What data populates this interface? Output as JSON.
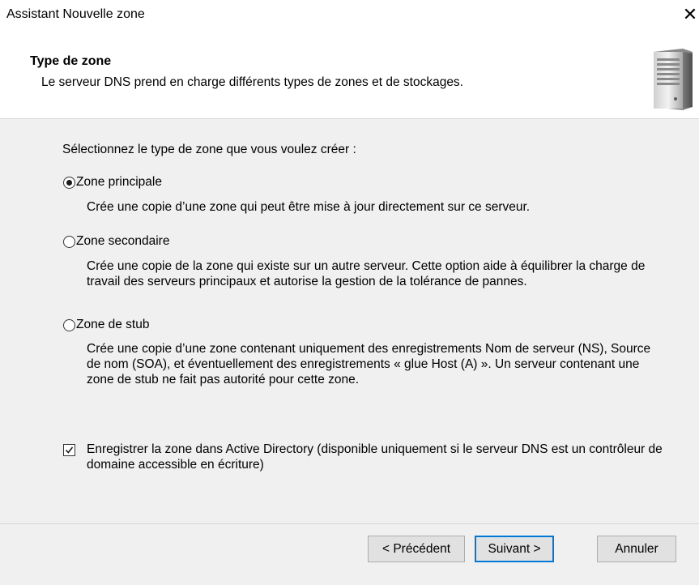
{
  "window": {
    "title": "Assistant Nouvelle zone",
    "close_glyph": "✕"
  },
  "header": {
    "title": "Type de zone",
    "subtitle": "Le serveur DNS prend en charge différents types de zones et de stockages.",
    "icon": "server-icon"
  },
  "main": {
    "prompt": "Sélectionnez le type de zone que vous voulez créer :",
    "options": [
      {
        "label": "Zone principale",
        "checked": true,
        "description": "Crée une copie d’une zone qui peut être mise à jour directement sur ce serveur."
      },
      {
        "label": "Zone secondaire",
        "checked": false,
        "description": "Crée une copie de la zone qui existe sur un autre serveur. Cette option aide à équilibrer la charge de travail des serveurs principaux et autorise la gestion de la tolérance de pannes."
      },
      {
        "label": "Zone de stub",
        "checked": false,
        "description": "Crée une copie d’une zone contenant uniquement des enregistrements Nom de serveur (NS), Source de nom (SOA), et éventuellement des enregistrements « glue Host (A) ». Un serveur contenant une zone de stub ne fait pas autorité pour cette zone."
      }
    ],
    "ad_checkbox": {
      "label": "Enregistrer la zone dans Active Directory (disponible uniquement si le serveur DNS est un contrôleur de domaine accessible en écriture)",
      "checked": true
    }
  },
  "footer": {
    "back_label": "< Précédent",
    "next_label": "Suivant >",
    "cancel_label": "Annuler"
  },
  "colors": {
    "content_bg": "#f0f0f0",
    "accent": "#0078d7"
  }
}
